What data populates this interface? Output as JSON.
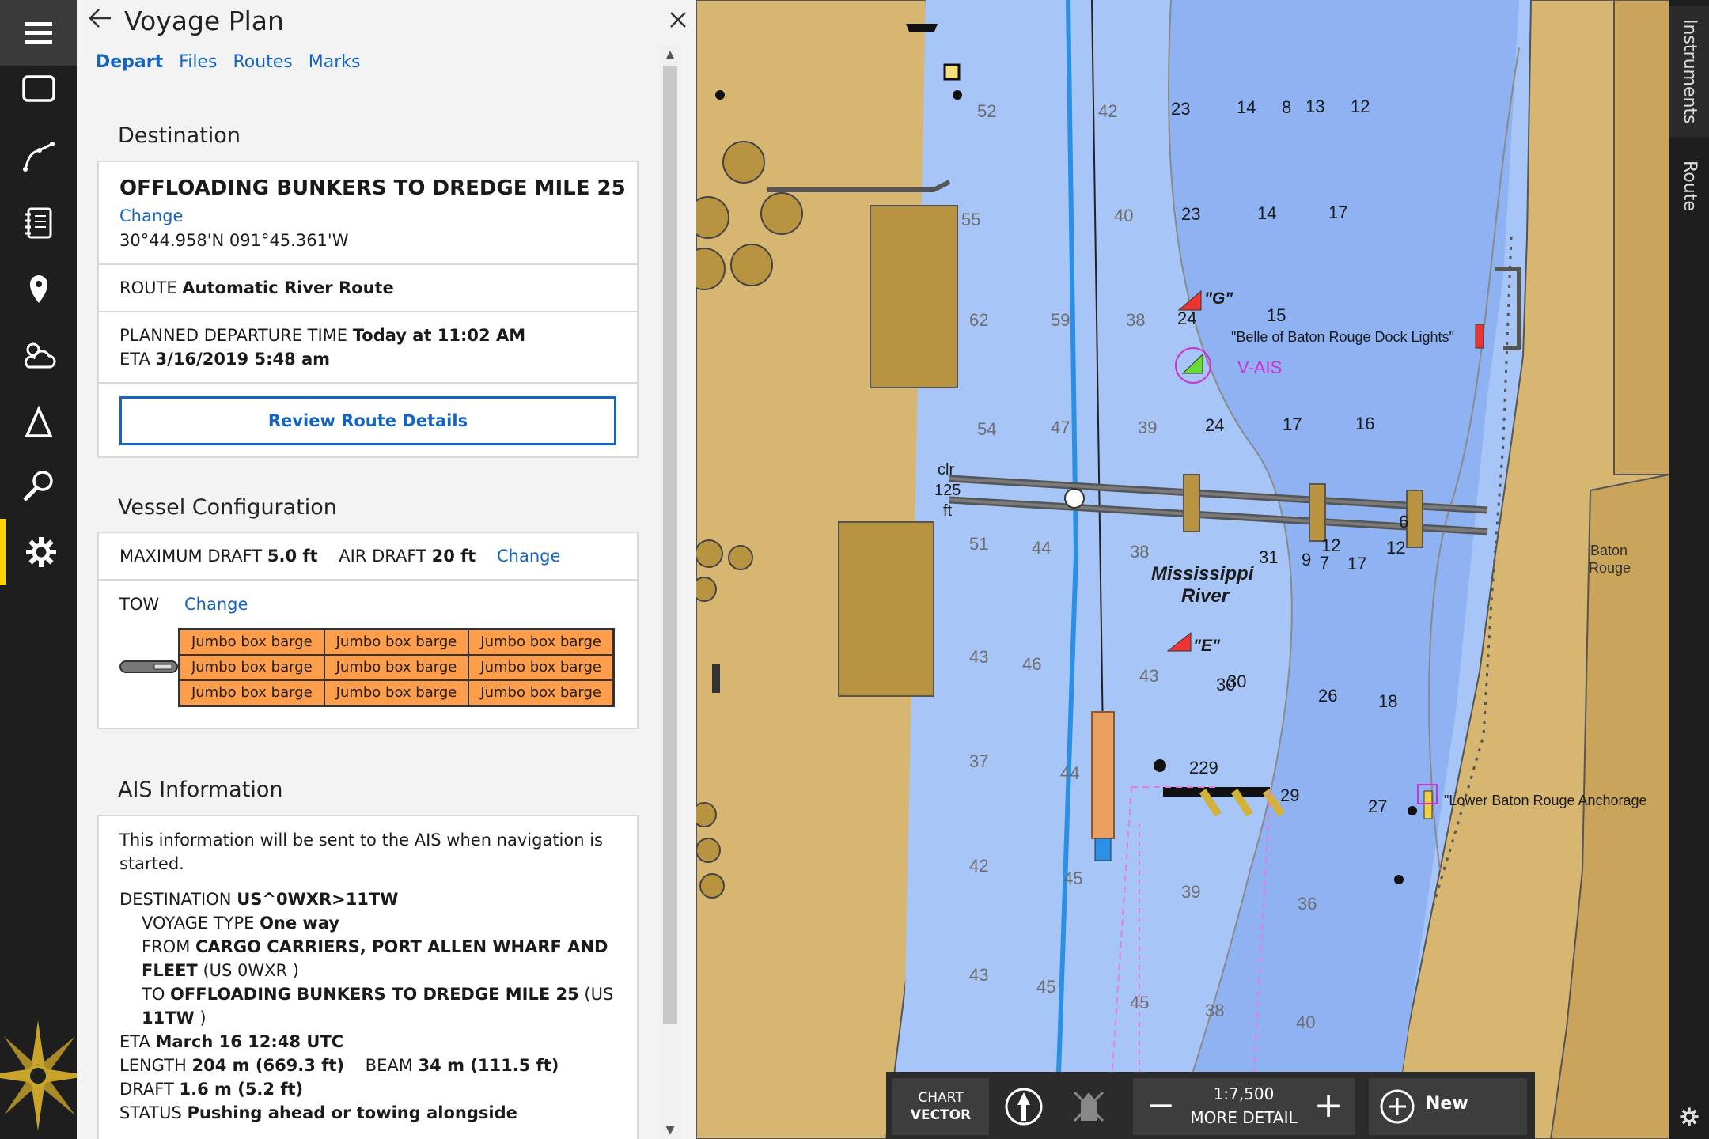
{
  "rail": {
    "items": [
      {
        "name": "menu-icon"
      },
      {
        "name": "chart-frame-icon"
      },
      {
        "name": "route-icon"
      },
      {
        "name": "logbook-icon"
      },
      {
        "name": "location-pin-icon"
      },
      {
        "name": "weather-icon"
      },
      {
        "name": "delta-icon"
      },
      {
        "name": "search-icon"
      },
      {
        "name": "settings-icon"
      }
    ],
    "accent": "#ffd400"
  },
  "panel": {
    "title": "Voyage Plan",
    "tabs": [
      "Depart",
      "Files",
      "Routes",
      "Marks"
    ],
    "destination": {
      "heading": "Destination",
      "name": "OFFLOADING BUNKERS TO DREDGE MILE 25",
      "change": "Change",
      "coords": "30°44.958'N 091°45.361'W",
      "route_label": "ROUTE",
      "route_value": "Automatic River Route",
      "departure_label": "PLANNED DEPARTURE TIME",
      "departure_value": "Today at 11:02 AM",
      "eta_label": "ETA",
      "eta_value": "3/16/2019 5:48 am",
      "review_button": "Review Route Details"
    },
    "vessel": {
      "heading": "Vessel Configuration",
      "max_draft_label": "MAXIMUM DRAFT",
      "max_draft_value": "5.0 ft",
      "air_draft_label": "AIR DRAFT",
      "air_draft_value": "20 ft",
      "change": "Change",
      "tow_label": "TOW",
      "tow_change": "Change",
      "barges": [
        "Jumbo box barge",
        "Jumbo box barge",
        "Jumbo box barge",
        "Jumbo box barge",
        "Jumbo box barge",
        "Jumbo box barge",
        "Jumbo box barge",
        "Jumbo box barge",
        "Jumbo box barge"
      ]
    },
    "ais": {
      "heading": "AIS Information",
      "intro_line1": "This information will be sent to the AIS when navigation is",
      "intro_line2": "started.",
      "destination_label": "DESTINATION",
      "destination_value": "US^0WXR>11TW",
      "voyage_type_label": "VOYAGE TYPE",
      "voyage_type_value": "One way",
      "from_label": "FROM",
      "from_value_line1": "CARGO CARRIERS, PORT ALLEN WHARF AND",
      "from_value_line2": "FLEET",
      "from_code": "(US 0WXR )",
      "to_label": "TO",
      "to_value": "OFFLOADING BUNKERS TO DREDGE MILE 25",
      "to_code_part1": "(US",
      "to_code_line2_bold": "11TW",
      "to_code_part2": " )",
      "eta_label": "ETA",
      "eta_value": "March 16 12:48 UTC",
      "length_label": "LENGTH",
      "length_value": "204 m (669.3 ft)",
      "beam_label": "BEAM",
      "beam_value": "34 m (111.5 ft)",
      "draft_label": "DRAFT",
      "draft_value": "1.6 m (5.2 ft)",
      "status_label": "STATUS",
      "status_value": "Pushing ahead or towing alongside"
    }
  },
  "chart": {
    "river_name_line1": "Mississippi",
    "river_name_line2": "River",
    "city_line1": "Baton",
    "city_line2": "Rouge",
    "bridge_label_line1": "clr",
    "bridge_label_line2": "125",
    "bridge_label_line3": "ft",
    "buoy_g": "\"G\"",
    "buoy_e": "\"E\"",
    "dock_lights": "\"Belle of Baton Rouge Dock Lights\"",
    "anchorage": "\"Lower Baton Rouge Anchorage",
    "vais": "V-AIS",
    "colors": {
      "water": "#a7c5f7",
      "deep_water": "#8fb2f2",
      "land": "#d7b672",
      "structures": "#b89440",
      "channel": "#2b8fe6"
    }
  },
  "right_tabs": [
    "Instruments",
    "Route"
  ],
  "toolbar": {
    "chart_line1": "CHART",
    "chart_line2": "VECTOR",
    "scale": "1:7,500",
    "detail": "MORE DETAIL",
    "minus": "−",
    "plus": "+",
    "new": "New"
  }
}
